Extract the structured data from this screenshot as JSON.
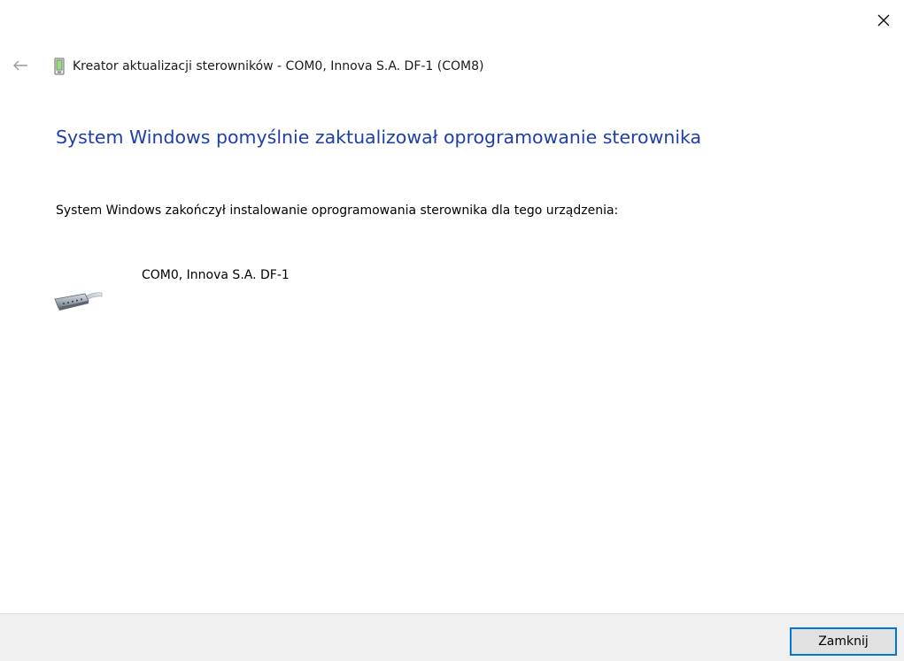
{
  "window": {
    "title": "Kreator aktualizacji sterowników - COM0, Innova S.A. DF-1 (COM8)"
  },
  "main": {
    "heading": "System Windows pomyślnie zaktualizował oprogramowanie sterownika",
    "description": "System Windows zakończył instalowanie oprogramowania sterownika dla tego urządzenia:",
    "device_name": "COM0, Innova S.A. DF-1"
  },
  "footer": {
    "close_button_label": "Zamknij"
  },
  "colors": {
    "heading": "#1e3ea8",
    "footer_bg": "#f0f0f0",
    "button_border": "#0078d7"
  },
  "icons": {
    "close": "close-icon",
    "back": "back-arrow-icon",
    "header": "device-manager-icon",
    "device": "serial-port-icon"
  }
}
